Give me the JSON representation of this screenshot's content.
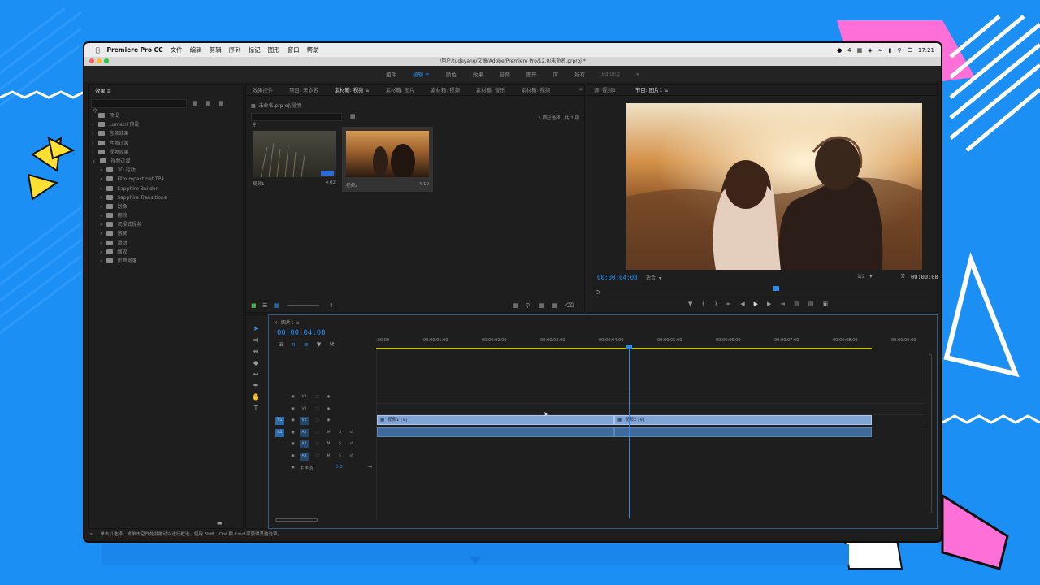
{
  "menubar": {
    "app_name": "Premiere Pro CC",
    "items": [
      "文件",
      "编辑",
      "剪辑",
      "序列",
      "标记",
      "图形",
      "窗口",
      "帮助"
    ],
    "status": "4",
    "clock": "17:21"
  },
  "window": {
    "title": "/用户/tudeyang/文稿/Adobe/Premiere Pro/12.0/未命名.prproj *"
  },
  "workspaces": {
    "items": [
      "组件",
      "编辑",
      "颜色",
      "效果",
      "音频",
      "图形",
      "库",
      "所有",
      "Editing"
    ],
    "active": "编辑"
  },
  "effects_panel": {
    "tab": "效果",
    "search_placeholder": "",
    "tree": [
      {
        "label": "预设",
        "level": 0
      },
      {
        "label": "Lumetri 预设",
        "level": 0
      },
      {
        "label": "音频效果",
        "level": 0
      },
      {
        "label": "音频过渡",
        "level": 0
      },
      {
        "label": "视频效果",
        "level": 0
      },
      {
        "label": "视频过渡",
        "level": 0
      },
      {
        "label": "3D 运动",
        "level": 1
      },
      {
        "label": "FilmImpact.net TP4",
        "level": 1
      },
      {
        "label": "Sapphire Builder",
        "level": 1
      },
      {
        "label": "Sapphire Transitions",
        "level": 1
      },
      {
        "label": "划像",
        "level": 1
      },
      {
        "label": "擦除",
        "level": 1
      },
      {
        "label": "沉浸式视频",
        "level": 1
      },
      {
        "label": "溶解",
        "level": 1
      },
      {
        "label": "滑动",
        "level": 1
      },
      {
        "label": "缩放",
        "level": 1
      },
      {
        "label": "页面剥落",
        "level": 1
      }
    ]
  },
  "project_panel": {
    "tabs": [
      "效果控件",
      "项目: 未命名",
      "素材箱: 视频",
      "素材箱: 图片",
      "素材箱: 视频",
      "素材箱: 音乐",
      "素材箱: 视频"
    ],
    "active_tab": 2,
    "path": "未命名.prproj\\视频",
    "selection_info": "1 项已选择，共 2 项",
    "clips": [
      {
        "name": "视频1",
        "duration": "4:02"
      },
      {
        "name": "视频2",
        "duration": "4:10"
      }
    ]
  },
  "program_monitor": {
    "tabs": [
      "源: 视频1",
      "节目: 图片1"
    ],
    "active_tab": 1,
    "timecode": "00:00:04:08",
    "fit": "适合",
    "resolution": "1/2",
    "duration": "00:00:08"
  },
  "timeline": {
    "sequence": "图片1",
    "timecode": "00:00:04:08",
    "ruler": [
      ":00:00",
      "00:00:01:00",
      "00:00:02:00",
      "00:00:03:00",
      "00:00:04:00",
      "00:00:05:00",
      "00:00:06:00",
      "00:00:07:00",
      "00:00:08:00",
      "00:00:09:00"
    ],
    "video_tracks": [
      "V3",
      "V2",
      "V1"
    ],
    "audio_tracks": [
      "A1",
      "A2",
      "A3"
    ],
    "master": {
      "label": "主声道",
      "value": "0.0"
    },
    "source_patch": {
      "video": "V1",
      "audio": "A1"
    },
    "track_buttons": [
      "M",
      "S"
    ],
    "clips": [
      {
        "name": "视频1 [V]"
      },
      {
        "name": "视频2 [V]"
      }
    ],
    "playhead_fraction": 0.51
  },
  "statusbar": {
    "text": "单击以选择，或单击空白处并拖动以进行框选。使用 Shift、Opt 和 Cmd 可获得其他选项。"
  },
  "colors": {
    "accent": "#2d8ceb",
    "clip": "#7fa4d6",
    "background": "#1c8ff5"
  }
}
